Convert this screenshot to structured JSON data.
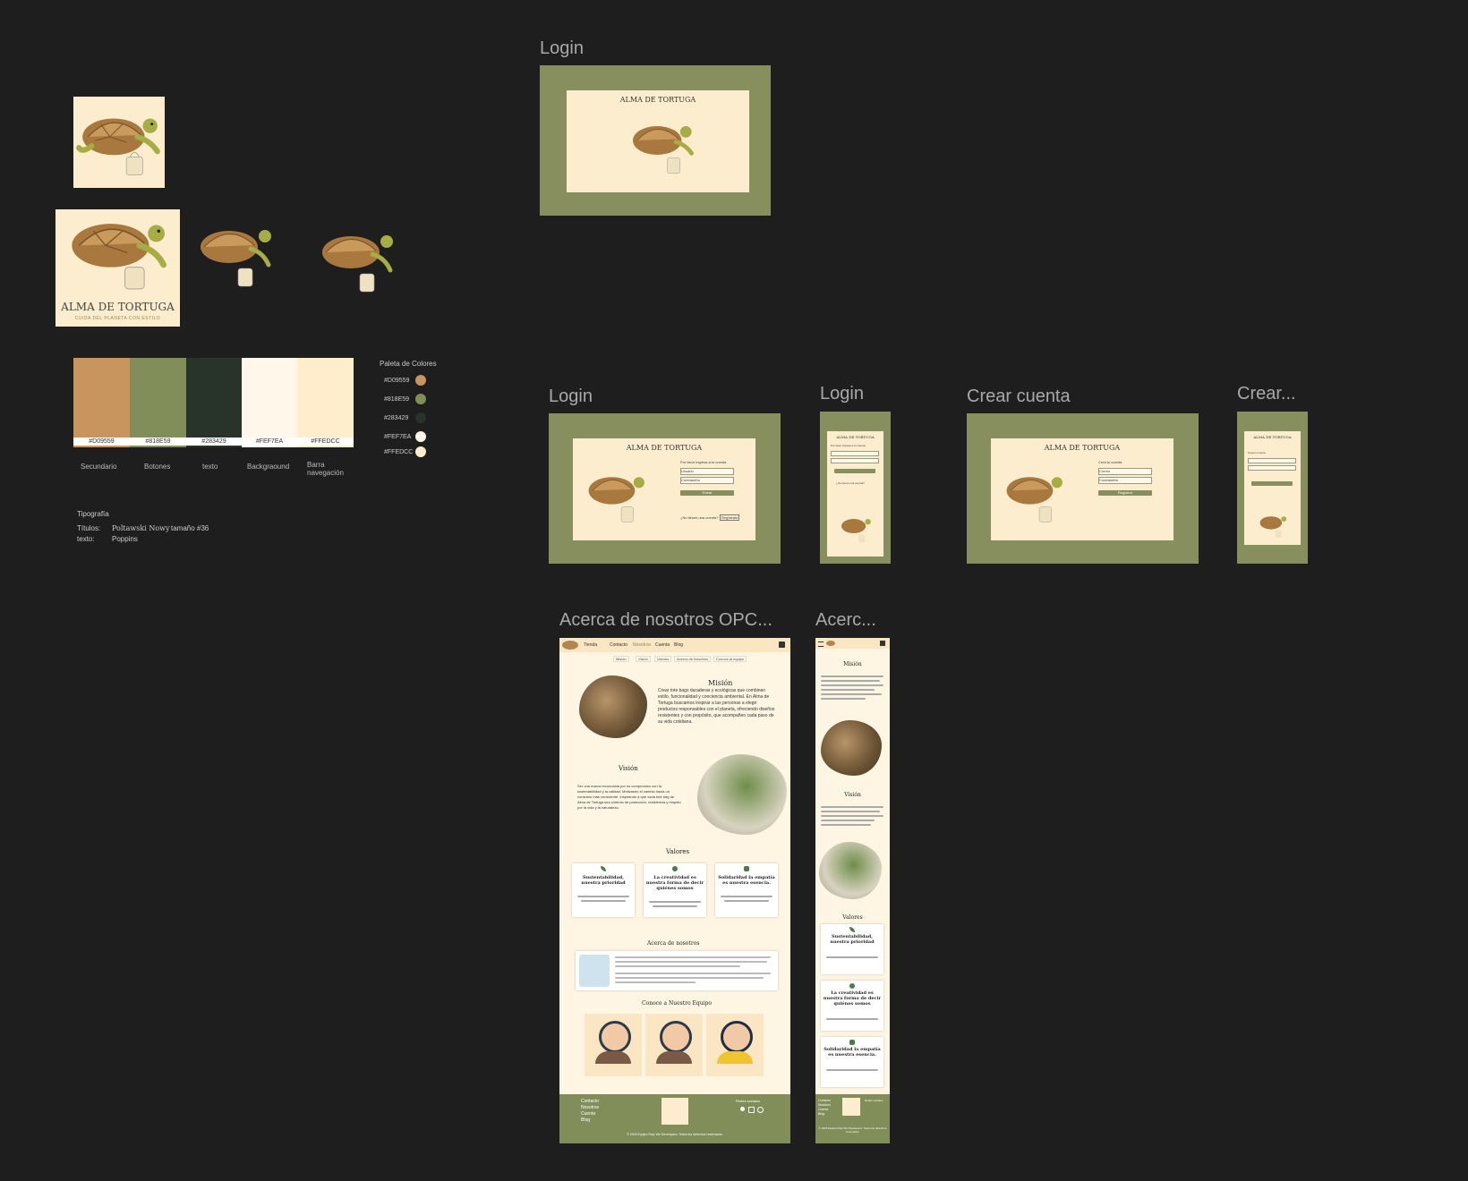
{
  "frames": {
    "login_main": "Login",
    "login_desktop": "Login",
    "login_mobile": "Login",
    "crear_desktop": "Crear cuenta",
    "crear_mobile": "Crear...",
    "about_desktop": "Acerca de nosotros OPC...",
    "about_mobile": "Acerc..."
  },
  "brand": {
    "name": "ALMA DE TORTUGA",
    "tagline": "CUIDA DEL PLANETA CON ESTILO"
  },
  "palette": {
    "title": "Paleta de Colores",
    "swatches": [
      {
        "hex": "#D09559",
        "name": "Secundario",
        "color": "#c8955f"
      },
      {
        "hex": "#818E59",
        "name": "Botones",
        "color": "#818e59"
      },
      {
        "hex": "#283429",
        "name": "texto",
        "color": "#283429"
      },
      {
        "hex": "#FEF7EA",
        "name": "Backgraound",
        "color": "#fef7ea"
      },
      {
        "hex": "#FFEDCC",
        "name": "Barra navegación",
        "color": "#ffedcc"
      }
    ]
  },
  "typography": {
    "title": "Tipografía",
    "titles_label": "Títulos:",
    "titles_font": "Poltawski Nowy",
    "size": "tamaño #36",
    "text_label": "texto:",
    "text_font": "Poppins"
  },
  "login": {
    "prompt": "Por favor ingresa a tu cuenta",
    "user": "Usuario",
    "password": "Contraseña",
    "enter": "Entrar",
    "no_account": "¿No tienes una cuenta?",
    "register": "Regístrate"
  },
  "signup": {
    "prompt": "Crea tu cuenta",
    "user": "Correo",
    "password": "Contraseña",
    "button": "Registrar"
  },
  "about": {
    "nav": [
      "Tienda",
      "Contacto",
      "Nosotros",
      "Cuenta",
      "Blog"
    ],
    "subnav": [
      "Misión",
      "Visión",
      "Valores",
      "Acerca de Nosotros",
      "Conoce al equipo"
    ],
    "mission_title": "Misión",
    "mission_text": "Crear tote bags duraderas y ecológicas que combinen estilo, funcionalidad y conciencia ambiental. En Alma de Tortuga buscamos inspirar a las personas a elegir productos responsables con el planeta, ofreciendo diseños resistentes y con propósito, que acompañen cada paso de su vida cotidiana.",
    "vision_title": "Visión",
    "vision_text": "Ser una marca reconocida por su compromiso con la sustentabilidad y la calidad. Motivando el cambio hacia un consumo más consciente. Inspirando a que cada tote bag de Alma de Tortuga sea símbolo de protección, resistencia y respeto por la vida y la naturaleza.",
    "values_title": "Valores",
    "values": [
      {
        "title": "Sustentabilidad, nuestra prioridad"
      },
      {
        "title": "La creatividad es nuestra forma de decir quiénes somos"
      },
      {
        "title": "Solidaridad la empatía es nuestra esencia."
      }
    ],
    "about_title": "Acerca de nosotros",
    "team_title": "Conoce a Nuestro Equipo",
    "footer_links": [
      "Contacto",
      "Nosotros",
      "Cuenta",
      "Blog"
    ],
    "social_title": "Redes sociales",
    "copyright": "© 2025 Equipo Rojo We Developers. Todos los derechos reservados."
  }
}
